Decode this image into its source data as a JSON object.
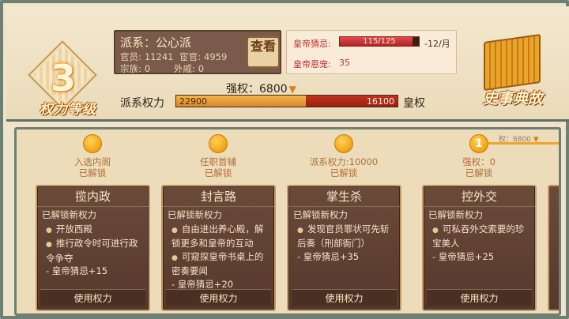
{
  "rank": {
    "number": "3",
    "label": "权力等级"
  },
  "faction": {
    "name": "派系：公心派",
    "officials_label": "官员:",
    "officials_value": "11241",
    "eunuchs_label": "宦官:",
    "eunuchs_value": "4959",
    "clan_label": "宗族:",
    "clan_value": "0",
    "inlaws_label": "外戚:",
    "inlaws_value": "0",
    "view_button": "查看"
  },
  "emperor": {
    "suspicion_label": "皇帝猜忌:",
    "suspicion_text": "115/125",
    "suspicion_fraction": 0.92,
    "suspicion_delta": "-12/月",
    "favor_label": "皇帝恩宠:",
    "favor_value": "35",
    "colors": {
      "suspicion": "#c23030"
    }
  },
  "power": {
    "strength_text": "强权：6800",
    "faction_label": "派系权力",
    "imperial_label": "皇权",
    "faction_value": "22900",
    "imperial_value": "16100",
    "faction_share": 0.585
  },
  "history": {
    "title": "史事典故"
  },
  "track": {
    "mini_label": "权：6800",
    "milestones": [
      {
        "dot": "",
        "req": "入选内阁",
        "status": "已解锁"
      },
      {
        "dot": "",
        "req": "任职首辅",
        "status": "已解锁"
      },
      {
        "dot": "",
        "req": "派系权力:10000",
        "status": "已解锁"
      },
      {
        "dot": "1",
        "req": "强权：0",
        "status": "已解锁"
      }
    ]
  },
  "cards": [
    {
      "title": "揽内政",
      "head": "已解锁新权力",
      "bullets": [
        "开放西殿",
        "推行政令时可进行政令争夺"
      ],
      "effect": "-  皇帝猜忌+15",
      "button": "使用权力"
    },
    {
      "title": "封言路",
      "head": "已解锁新权力",
      "bullets": [
        "自由进出养心殿，解锁更多和皇帝的互动",
        "可窥探皇帝书桌上的密奏要闻"
      ],
      "effect": "-  皇帝猜忌+20",
      "button": "使用权力"
    },
    {
      "title": "掌生杀",
      "head": "已解锁新权力",
      "bullets": [
        "发现官员罪状可先斩后奏（刑部衙门）"
      ],
      "effect": "-  皇帝猜忌+35",
      "button": "使用权力"
    },
    {
      "title": "控外交",
      "head": "已解锁新权力",
      "bullets": [
        "可私吞外交索要的珍宝美人"
      ],
      "effect": "-  皇帝猜忌+25",
      "button": "使用权力"
    }
  ]
}
